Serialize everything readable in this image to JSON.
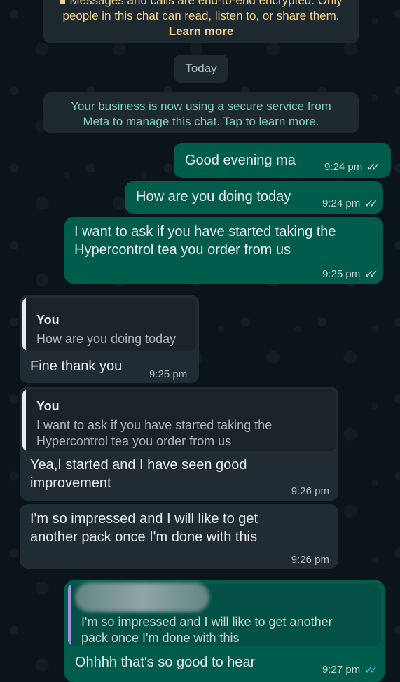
{
  "system": {
    "encryption_line1": "Messages and calls are end-to-end encrypted. Only",
    "encryption_line2": "people in this chat can read, listen to, or share them.",
    "learn_more": "Learn more",
    "date_divider": "Today",
    "business_line1": "Your business is now using a secure service from",
    "business_line2": "Meta to manage this chat. Tap to learn more."
  },
  "messages": [
    {
      "direction": "outgoing",
      "text": "Good evening ma",
      "time": "9:24 pm",
      "status": "delivered"
    },
    {
      "direction": "outgoing",
      "text": "How are you doing today",
      "time": "9:24 pm",
      "status": "delivered"
    },
    {
      "direction": "outgoing",
      "lines": [
        "I want to ask if you have started taking the",
        "Hypercontrol tea you order from us"
      ],
      "time": "9:25 pm",
      "status": "delivered"
    },
    {
      "direction": "incoming",
      "quote": {
        "author": "You",
        "text": "How are you doing today"
      },
      "text": "Fine thank you",
      "time": "9:25 pm"
    },
    {
      "direction": "incoming",
      "quote": {
        "author": "You",
        "lines": [
          "I want to ask if you have started taking the",
          "Hypercontrol tea you order from us"
        ]
      },
      "lines": [
        "Yea,I started and I have seen good",
        "improvement"
      ],
      "time": "9:26 pm"
    },
    {
      "direction": "incoming",
      "lines": [
        "I'm so impressed and I will like to get",
        "another pack once I'm done with this"
      ],
      "time": "9:26 pm"
    },
    {
      "direction": "outgoing",
      "quote": {
        "lines": [
          "I'm so impressed and I will like to get another",
          "pack once I'm done with this"
        ]
      },
      "text": "Ohhhh that's so good to hear",
      "time": "9:27 pm",
      "status": "read"
    }
  ],
  "colors": {
    "background": "#0b141a",
    "outgoing_bubble": "#005c4b",
    "incoming_bubble": "#202c33",
    "system_text": "#f7d48b",
    "business_text": "#7fd1b8",
    "read_ticks": "#53bdeb"
  }
}
